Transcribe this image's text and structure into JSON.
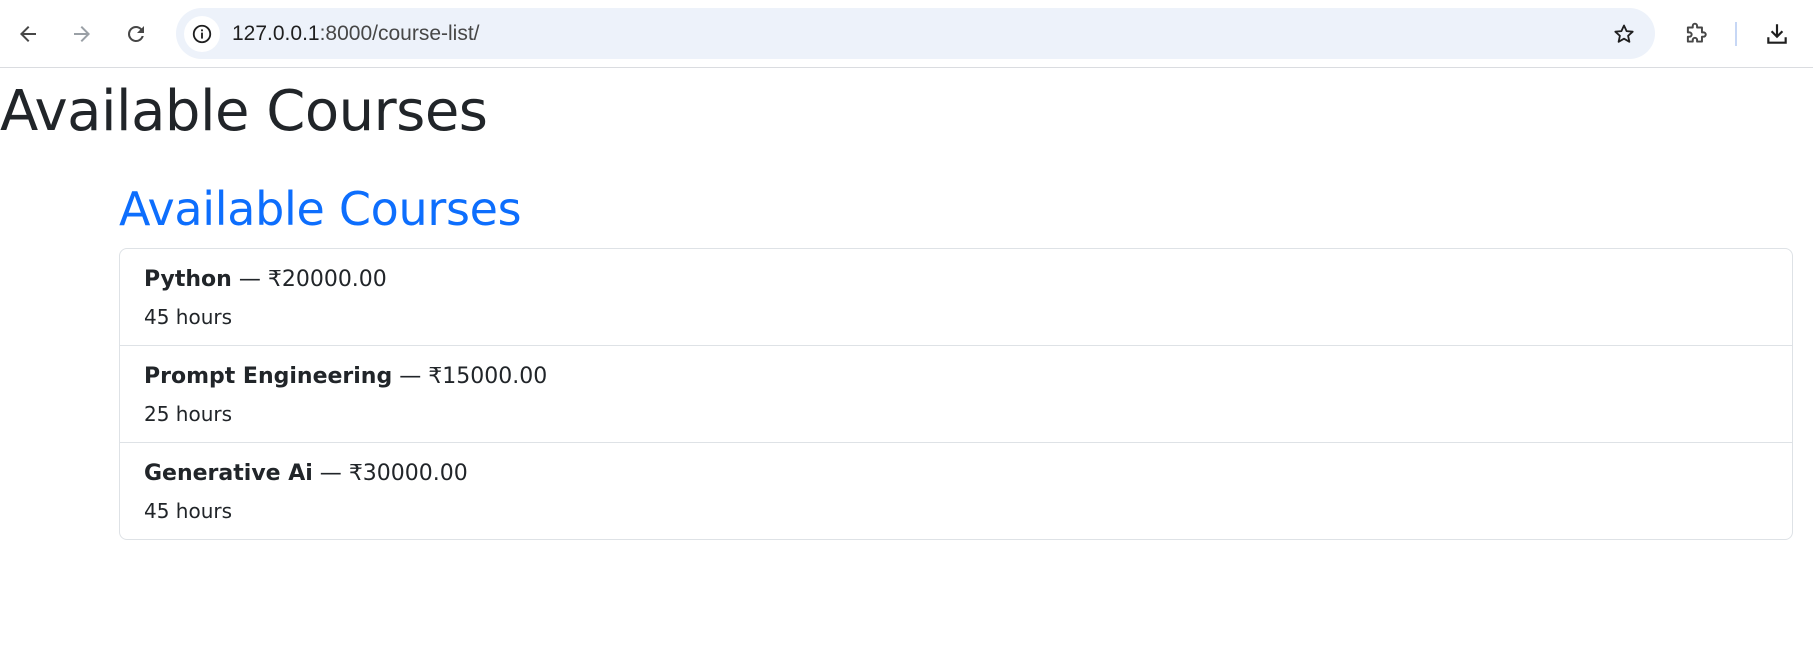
{
  "browser": {
    "url_host": "127.0.0.1",
    "url_path": ":8000/course-list/"
  },
  "page": {
    "title": "Available Courses",
    "section_title": "Available Courses"
  },
  "courses": [
    {
      "name": "Python",
      "separator": " — ",
      "price": "₹20000.00",
      "hours": "45 hours"
    },
    {
      "name": "Prompt Engineering",
      "separator": " — ",
      "price": "₹15000.00",
      "hours": "25 hours"
    },
    {
      "name": "Generative Ai",
      "separator": " — ",
      "price": "₹30000.00",
      "hours": "45 hours"
    }
  ],
  "colors": {
    "accent": "#0d6efd",
    "text": "#212529",
    "border": "#dee2e6",
    "omnibox": "#edf2fa"
  }
}
